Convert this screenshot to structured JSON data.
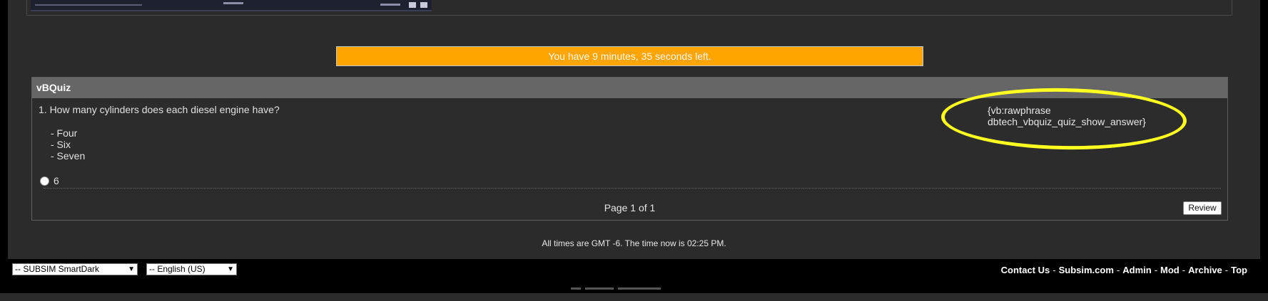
{
  "timer": {
    "text": "You have 9 minutes, 35 seconds left."
  },
  "quiz": {
    "header": "vBQuiz",
    "question": "1. How many cylinders does each diesel engine have?",
    "options": [
      "- Four",
      "- Six",
      "- Seven"
    ],
    "answer_value": "6",
    "phrase_lines": [
      "{vb:rawphrase",
      "dbtech_vbquiz_quiz_show_answer}"
    ],
    "page_label": "Page 1 of 1",
    "review_label": "Review"
  },
  "time_note": "All times are GMT -6. The time now is 02:25 PM.",
  "footer": {
    "style_select": "-- SUBSIM SmartDark",
    "language_select": "-- English (US)",
    "links": [
      "Contact Us",
      "Subsim.com",
      "Admin",
      "Mod",
      "Archive",
      "Top"
    ]
  },
  "colors": {
    "timer_bg": "#ffa500",
    "highlight": "#ffff22",
    "header_bg": "#666666"
  }
}
